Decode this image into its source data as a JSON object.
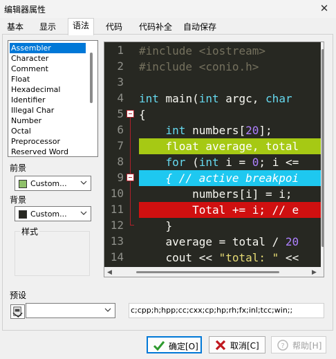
{
  "window": {
    "title": "编辑器属性",
    "close_glyph": "✕"
  },
  "tabs": [
    {
      "label": "基本",
      "active": false
    },
    {
      "label": "显示",
      "active": false
    },
    {
      "label": "语法",
      "active": true
    },
    {
      "label": "代码",
      "active": false
    },
    {
      "label": "代码补全",
      "active": false
    },
    {
      "label": "自动保存",
      "active": false
    }
  ],
  "syntax_list": {
    "items": [
      "Assembler",
      "Character",
      "Comment",
      "Float",
      "Hexadecimal",
      "Identifier",
      "Illegal Char",
      "Number",
      "Octal",
      "Preprocessor",
      "Reserved Word"
    ],
    "selected": "Assembler"
  },
  "foreground": {
    "label": "前景",
    "value": "Custom...",
    "color": "#8fc06a"
  },
  "background": {
    "label": "背景",
    "value": "Custom...",
    "color": "#272822"
  },
  "style_group": {
    "label": "样式"
  },
  "editor": {
    "line_numbers": [
      "1",
      "2",
      "3",
      "4",
      "5",
      "6",
      "7",
      "8",
      "9",
      "10",
      "11",
      "12",
      "13",
      "14"
    ],
    "lines": [
      [
        {
          "t": "#include <iostream>",
          "c": "#75715e"
        }
      ],
      [
        {
          "t": "#include <conio.h>",
          "c": "#75715e"
        }
      ],
      [],
      [
        {
          "t": "int",
          "c": "#66d9ef"
        },
        {
          "t": " main(",
          "c": "#f8f8f2"
        },
        {
          "t": "int",
          "c": "#66d9ef"
        },
        {
          "t": " argc, ",
          "c": "#f8f8f2"
        },
        {
          "t": "char",
          "c": "#66d9ef"
        }
      ],
      [
        {
          "t": "{",
          "c": "#f8f8f2"
        }
      ],
      [
        {
          "t": "    ",
          "c": "#f8f8f2"
        },
        {
          "t": "int",
          "c": "#66d9ef"
        },
        {
          "t": " numbers[",
          "c": "#f8f8f2"
        },
        {
          "t": "20",
          "c": "#ae81ff"
        },
        {
          "t": "];",
          "c": "#f8f8f2"
        }
      ],
      [
        {
          "t": "    float average, total",
          "c": "#ffffff"
        }
      ],
      [
        {
          "t": "    ",
          "c": "#f8f8f2"
        },
        {
          "t": "for",
          "c": "#66d9ef"
        },
        {
          "t": " (",
          "c": "#f8f8f2"
        },
        {
          "t": "int",
          "c": "#66d9ef"
        },
        {
          "t": " i = ",
          "c": "#f8f8f2"
        },
        {
          "t": "0",
          "c": "#ae81ff"
        },
        {
          "t": "; i <=",
          "c": "#f8f8f2"
        }
      ],
      [
        {
          "t": "    { // active breakpoi",
          "c": "#ffffff",
          "i": true
        }
      ],
      [
        {
          "t": "        numbers[i] = i;",
          "c": "#f8f8f2"
        }
      ],
      [
        {
          "t": "        Total += i; // e",
          "c": "#ffffff"
        }
      ],
      [
        {
          "t": "    }",
          "c": "#f8f8f2"
        }
      ],
      [
        {
          "t": "    average = total / ",
          "c": "#f8f8f2"
        },
        {
          "t": "20",
          "c": "#ae81ff"
        }
      ],
      [
        {
          "t": "    cout << ",
          "c": "#f8f8f2"
        },
        {
          "t": "\"total: \"",
          "c": "#e6db74"
        },
        {
          "t": " <<",
          "c": "#f8f8f2"
        }
      ]
    ],
    "highlights": [
      {
        "line": 7,
        "color": "#a6c914"
      },
      {
        "line": 9,
        "color": "#1ec8f0"
      },
      {
        "line": 11,
        "color": "#d01010"
      }
    ]
  },
  "preset": {
    "label": "预设",
    "value": ""
  },
  "extensions": "c;cpp;h;hpp;cc;cxx;cp;hp;rh;fx;inl;tcc;win;;",
  "buttons": {
    "ok": "确定[O]",
    "cancel": "取消[C]",
    "help": "帮助[H]"
  }
}
